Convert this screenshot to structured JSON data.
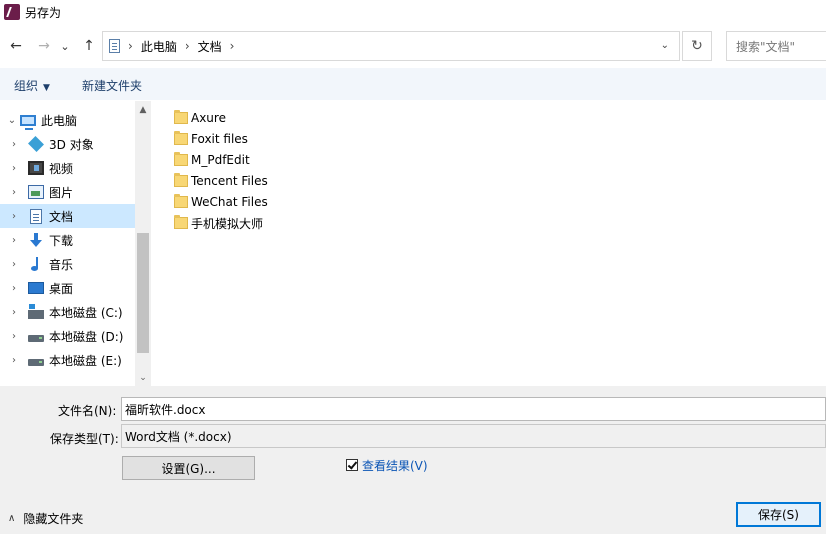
{
  "window": {
    "title": "另存为"
  },
  "nav": {
    "back_glyph": "←",
    "forward_glyph": "→",
    "recent_glyph": "⌄",
    "up_glyph": "↑"
  },
  "address": {
    "crumbs": [
      "此电脑",
      "文档"
    ],
    "separator": "›",
    "dropdown_glyph": "⌄",
    "refresh_glyph": "↻"
  },
  "search": {
    "placeholder": "搜索\"文档\""
  },
  "toolbar": {
    "organize_label": "组织",
    "organize_caret": "▼",
    "new_folder_label": "新建文件夹"
  },
  "tree": {
    "items": [
      {
        "label": "此电脑",
        "chevron": "⌄",
        "icon": "computer-icon"
      },
      {
        "label": "3D 对象",
        "chevron": "›",
        "icon": "cube-3d-icon"
      },
      {
        "label": "视频",
        "chevron": "›",
        "icon": "video-icon"
      },
      {
        "label": "图片",
        "chevron": "›",
        "icon": "picture-icon"
      },
      {
        "label": "文档",
        "chevron": "›",
        "icon": "document-icon",
        "selected": true
      },
      {
        "label": "下载",
        "chevron": "›",
        "icon": "download-arrow-icon"
      },
      {
        "label": "音乐",
        "chevron": "›",
        "icon": "music-note-icon"
      },
      {
        "label": "桌面",
        "chevron": "›",
        "icon": "desktop-icon"
      },
      {
        "label": "本地磁盘 (C:)",
        "chevron": "›",
        "icon": "system-drive-icon"
      },
      {
        "label": "本地磁盘 (D:)",
        "chevron": "›",
        "icon": "drive-icon"
      },
      {
        "label": "本地磁盘 (E:)",
        "chevron": "›",
        "icon": "drive-icon"
      }
    ],
    "scroll_up_glyph": "▲",
    "scroll_down_glyph": "⌄"
  },
  "files": [
    {
      "name": "Axure",
      "icon": "folder-icon"
    },
    {
      "name": "Foxit files",
      "icon": "folder-icon"
    },
    {
      "name": "M_PdfEdit",
      "icon": "folder-icon"
    },
    {
      "name": "Tencent Files",
      "icon": "folder-icon"
    },
    {
      "name": "WeChat Files",
      "icon": "folder-icon"
    },
    {
      "name": "手机模拟大师",
      "icon": "folder-icon"
    }
  ],
  "form": {
    "filename_label": "文件名(N):",
    "filename_value": "福昕软件.docx",
    "filetype_label": "保存类型(T):",
    "filetype_value": "Word文档 (*.docx)",
    "settings_button": "设置(G)...",
    "view_result_label": "查看结果(V)",
    "view_result_checked": true,
    "hide_folders_label": "隐藏文件夹",
    "hide_folders_caret": "∧",
    "save_button": "保存(S)"
  }
}
